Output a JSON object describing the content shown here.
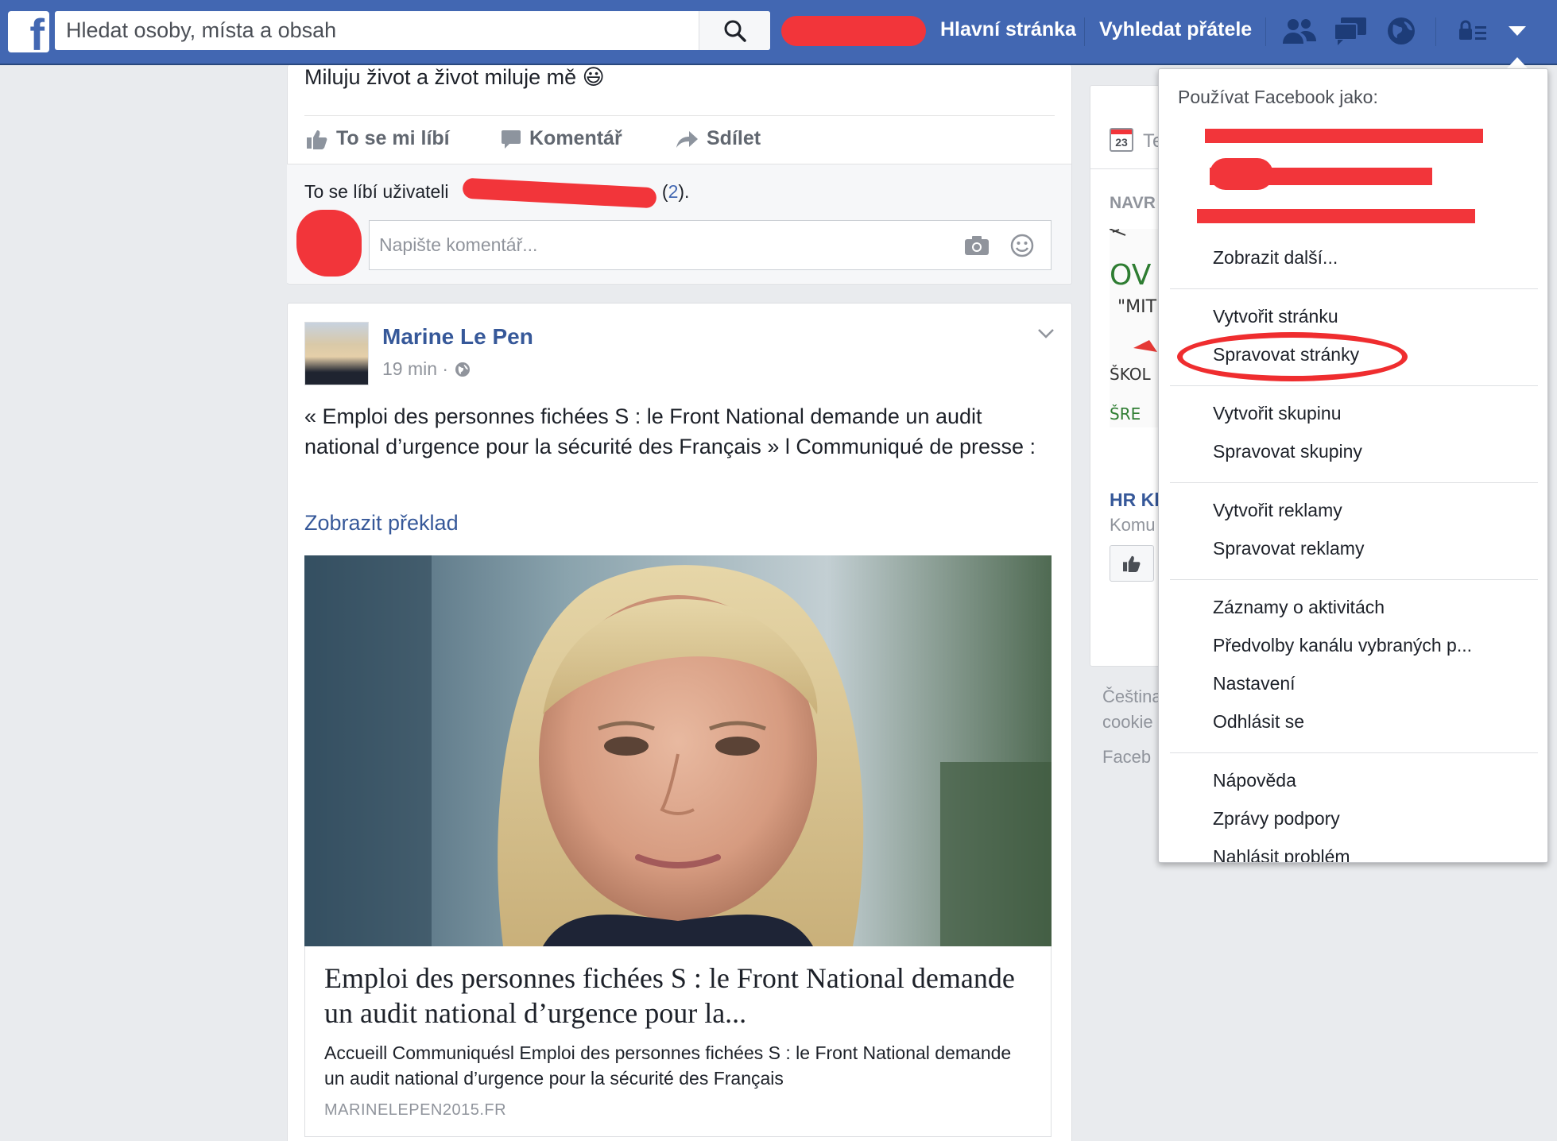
{
  "topbar": {
    "logo_letter": "f",
    "search_placeholder": "Hledat osoby, místa a obsah",
    "nav_home": "Hlavní stránka",
    "nav_find_friends": "Vyhledat přátele",
    "icons": [
      "friend-requests-icon",
      "messages-icon",
      "notifications-globe-icon",
      "privacy-lock-icon",
      "account-menu-arrow-icon"
    ]
  },
  "post1": {
    "text": "Miluju život a život miluje mě 😃",
    "actions": {
      "like": "To se mi líbí",
      "comment": "Komentář",
      "share": "Sdílet"
    },
    "likes_prefix": "To se líbí uživateli",
    "likes_count_open": "(",
    "likes_count": "2",
    "likes_count_close": ").",
    "comment_placeholder": "Napište komentář..."
  },
  "post2": {
    "author": "Marine Le Pen",
    "time": "19 min ·",
    "body": "« Emploi des personnes fichées S : le Front National demande un audit national d’urgence pour la sécurité des Français » l Communiqué de presse :",
    "translate": "Zobrazit překlad",
    "link": {
      "title": "Emploi des personnes fichées S : le Front National demande un audit national d’urgence pour la...",
      "description": "Accueill Communiquésl Emploi des personnes fichées S : le Front National demande un audit national d’urgence pour la sécurité des Français",
      "domain": "MARINELEPEN2015.FR"
    }
  },
  "right_column": {
    "calendar_day": "23",
    "calendar_label": "Te",
    "section_label": "NAVR",
    "hr_title": "HR Kl",
    "hr_sub": "Komu",
    "footer_lang": "Čeština",
    "footer_cookies": "cookie",
    "footer_fb": "Faceb"
  },
  "dropdown": {
    "header": "Používat Facebook jako:",
    "show_more": "Zobrazit další...",
    "items": [
      "Vytvořit stránku",
      "Spravovat stránky",
      "Vytvořit skupinu",
      "Spravovat skupiny",
      "Vytvořit reklamy",
      "Spravovat reklamy",
      "Záznamy o aktivitách",
      "Předvolby kanálu vybraných p...",
      "Nastavení",
      "Odhlásit se",
      "Nápověda",
      "Zprávy podpory",
      "Nahlásit problém"
    ]
  },
  "colors": {
    "brand_blue": "#4267b2",
    "link_blue": "#365899",
    "redaction_red": "#f2353a"
  }
}
